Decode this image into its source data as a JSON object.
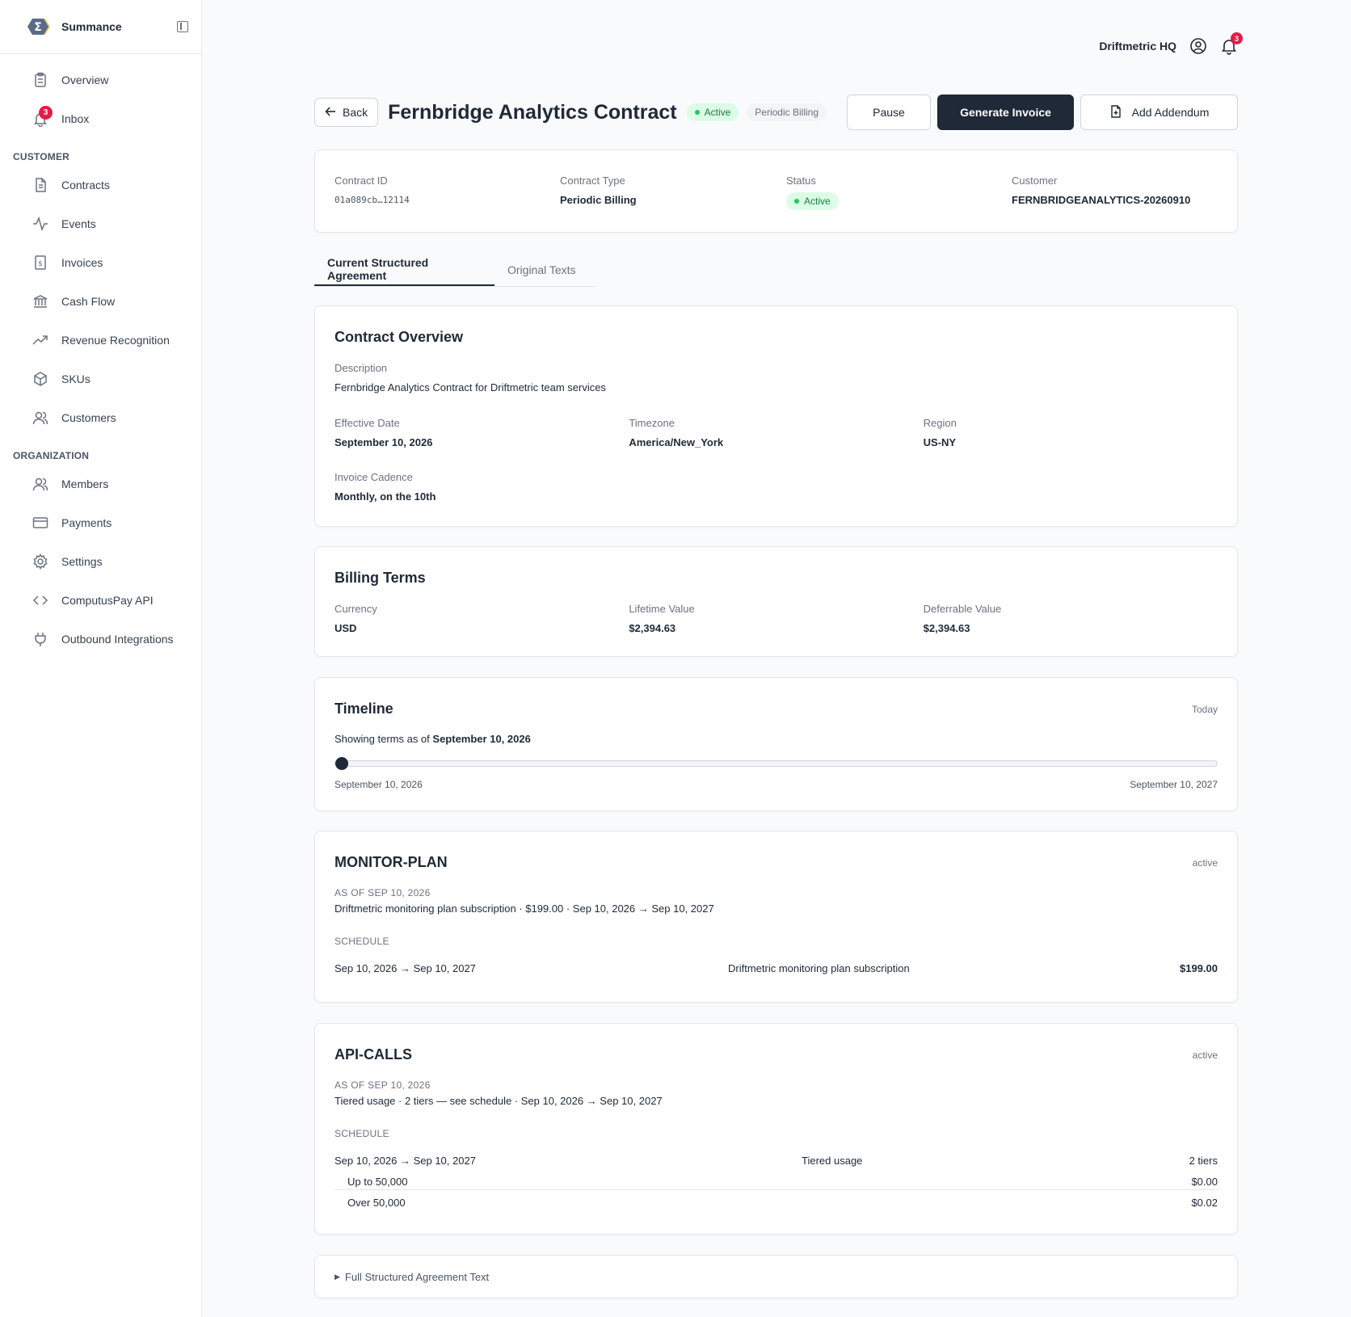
{
  "brand": {
    "name": "Summance"
  },
  "sidebar": {
    "top_items": [
      {
        "label": "Overview",
        "icon": "clipboard-icon"
      },
      {
        "label": "Inbox",
        "icon": "bell-icon",
        "badge": "3"
      }
    ],
    "customer_title": "CUSTOMER",
    "customer_items": [
      {
        "label": "Contracts"
      },
      {
        "label": "Events"
      },
      {
        "label": "Invoices"
      },
      {
        "label": "Cash Flow"
      },
      {
        "label": "Revenue Recognition"
      },
      {
        "label": "SKUs"
      },
      {
        "label": "Customers"
      }
    ],
    "org_title": "ORGANIZATION",
    "org_items": [
      {
        "label": "Members"
      },
      {
        "label": "Payments"
      },
      {
        "label": "Settings"
      },
      {
        "label": "ComputusPay API"
      },
      {
        "label": "Outbound Integrations"
      }
    ]
  },
  "topbar": {
    "org": "Driftmetric HQ",
    "notifications": "3"
  },
  "header": {
    "back": "Back",
    "title": "Fernbridge Analytics Contract",
    "status": "Active",
    "type": "Periodic Billing",
    "pause": "Pause",
    "generate": "Generate Invoice",
    "addendum": "Add Addendum"
  },
  "summary": {
    "contract_id_label": "Contract ID",
    "contract_id": "01a089cb…12114",
    "type_label": "Contract Type",
    "type": "Periodic Billing",
    "status_label": "Status",
    "status": "Active",
    "customer_label": "Customer",
    "customer": "FERNBRIDGEANALYTICS-20260910"
  },
  "tabs": [
    "Current Structured Agreement",
    "Original Texts"
  ],
  "overview": {
    "title": "Contract Overview",
    "desc_label": "Description",
    "desc": "Fernbridge Analytics Contract for Driftmetric team services",
    "eff_label": "Effective Date",
    "eff": "September 10, 2026",
    "tz_label": "Timezone",
    "tz": "America/New_York",
    "region_label": "Region",
    "region": "US-NY",
    "cadence_label": "Invoice Cadence",
    "cadence": "Monthly, on the 10th"
  },
  "billing": {
    "title": "Billing Terms",
    "currency_label": "Currency",
    "currency": "USD",
    "ltv_label": "Lifetime Value",
    "ltv": "$2,394.63",
    "def_label": "Deferrable Value",
    "def": "$2,394.63"
  },
  "timeline": {
    "title": "Timeline",
    "today": "Today",
    "showing_prefix": "Showing terms as of",
    "showing_date": "September 10, 2026",
    "start": "September 10, 2026",
    "end": "September 10, 2027",
    "position": 0
  },
  "monitor": {
    "title": "MONITOR-PLAN",
    "state": "active",
    "as_of": "AS OF SEP 10, 2026",
    "summary": "Driftmetric monitoring plan subscription · $199.00 · Sep 10, 2026 → Sep 10, 2027",
    "schedule_label": "SCHEDULE",
    "period": "Sep 10, 2026 → Sep 10, 2027",
    "desc": "Driftmetric monitoring plan subscription",
    "amount": "$199.00"
  },
  "api": {
    "title": "API-CALLS",
    "state": "active",
    "as_of": "AS OF SEP 10, 2026",
    "summary": "Tiered usage · 2 tiers — see schedule · Sep 10, 2026 → Sep 10, 2027",
    "schedule_label": "SCHEDULE",
    "period": "Sep 10, 2026 → Sep 10, 2027",
    "desc": "Tiered usage",
    "tiers_count": "2 tiers",
    "tiers": [
      {
        "label": "Up to 50,000",
        "price": "$0.00"
      },
      {
        "label": "Over 50,000",
        "price": "$0.02"
      }
    ]
  },
  "full_text": {
    "label": "Full Structured Agreement Text"
  }
}
